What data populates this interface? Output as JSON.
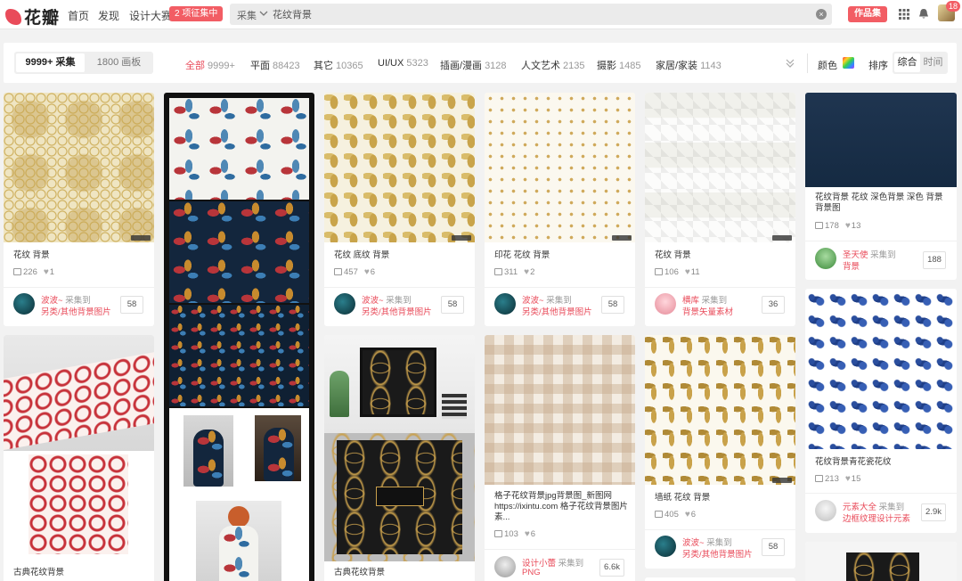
{
  "header": {
    "logo_text": "花瓣",
    "nav": [
      "首页",
      "发现",
      "设计大赛"
    ],
    "contest_badge": "2 项征集中",
    "search": {
      "scope": "采集",
      "value": "花纹背景"
    },
    "works_button": "作品集",
    "notification_count": "18"
  },
  "filter": {
    "toggle": {
      "active": "9999+ 采集",
      "inactive": "1800 画板"
    },
    "categories": [
      {
        "name": "全部",
        "count": "9999+",
        "active": true
      },
      {
        "name": "平面",
        "count": "88423"
      },
      {
        "name": "其它",
        "count": "10365"
      },
      {
        "name": "UI/UX",
        "count": "5323"
      },
      {
        "name": "插画/漫画",
        "count": "3128"
      },
      {
        "name": "人文艺术",
        "count": "2135"
      },
      {
        "name": "摄影",
        "count": "1485"
      },
      {
        "name": "家居/家装",
        "count": "1143"
      }
    ],
    "color_label": "颜色",
    "sort_label": "排序",
    "sort_options": {
      "active": "综合",
      "inactive": "时间"
    }
  },
  "pins": {
    "p1": {
      "title": "花纹 背景",
      "repins": "226",
      "likes": "1",
      "user": "波波~",
      "action": "采集到",
      "board": "另类/其他背景图片",
      "count": "58"
    },
    "p2": {
      "title": "古典花纹背景"
    },
    "p3": {
      "title": "花纹 底纹 背景",
      "repins": "457",
      "likes": "6",
      "user": "波波~",
      "action": "采集到",
      "board": "另类/其他背景图片",
      "count": "58"
    },
    "p4": {
      "title": "古典花纹背景"
    },
    "p5": {
      "title": "印花 花纹 背景",
      "repins": "311",
      "likes": "2",
      "user": "波波~",
      "action": "采集到",
      "board": "另类/其他背景图片",
      "count": "58"
    },
    "p6": {
      "title": "格子花纹背景jpg背景图_新图网 https://ixintu.com 格子花纹背景图片素...",
      "repins": "103",
      "likes": "6",
      "user": "设计小蕾",
      "action": "采集到",
      "board": "PNG",
      "count": "6.6k"
    },
    "p7": {
      "title": "花纹 背景",
      "repins": "106",
      "likes": "11",
      "user": "横库",
      "action": "采集到",
      "board": "背景矢量素材",
      "count": "36"
    },
    "p8": {
      "title": "墙纸 花纹 背景",
      "repins": "405",
      "likes": "6",
      "user": "波波~",
      "action": "采集到",
      "board": "另类/其他背景图片",
      "count": "58"
    },
    "p9": {
      "title": "花纹背景 花纹 深色背景 深色 背景 背景图",
      "repins": "178",
      "likes": "13",
      "user": "圣天使",
      "action": "采集到",
      "board": "背景",
      "count": "188"
    },
    "p10": {
      "title": "花纹背景青花瓷花纹",
      "repins": "213",
      "likes": "15",
      "user": "元素大全",
      "action": "采集到",
      "board": "边框纹理设计元素",
      "count": "2.9k"
    }
  },
  "colors": {
    "accent": "#e94b5a",
    "badge": "#f25d64"
  },
  "icons": [
    "chevron-down-icon",
    "clear-icon",
    "apps-grid-icon",
    "bell-icon",
    "repin-icon",
    "heart-icon",
    "expand-icon"
  ]
}
